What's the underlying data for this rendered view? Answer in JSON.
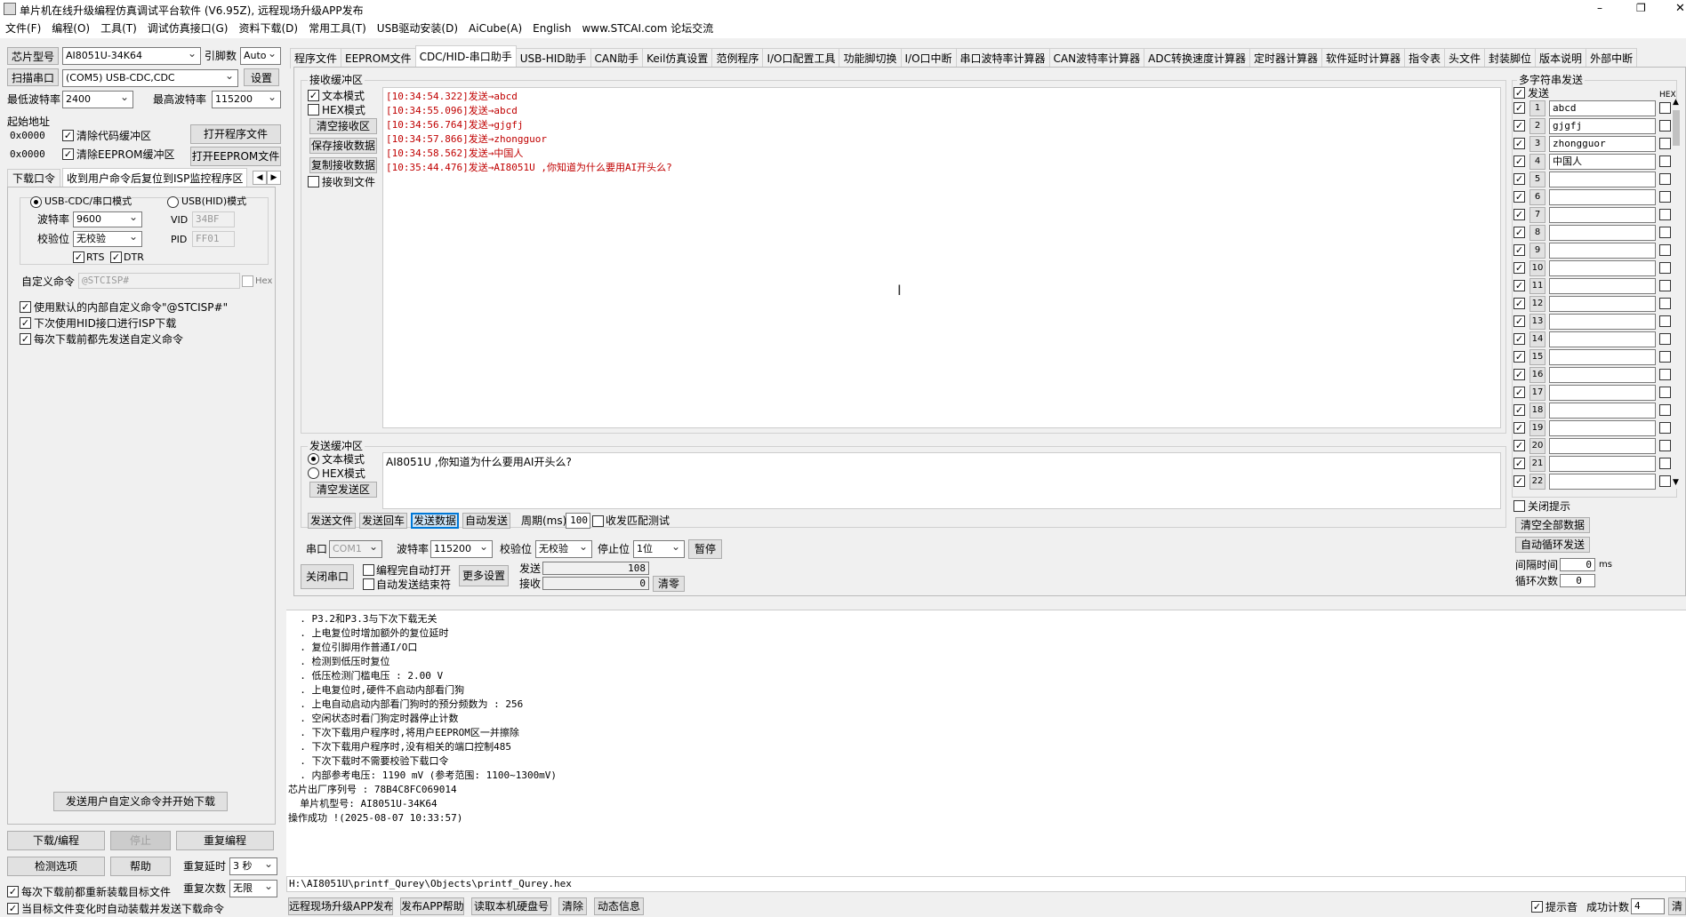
{
  "window": {
    "title": "单片机在线升级编程仿真调试平台软件 (V6.95Z), 远程现场升级APP发布",
    "controls": [
      "–",
      "❐",
      "✕"
    ]
  },
  "menu": [
    "文件(F)",
    "编程(O)",
    "工具(T)",
    "调试仿真接口(G)",
    "资料下载(D)",
    "常用工具(T)",
    "USB驱动安装(D)",
    "AiCube(A)",
    "English",
    "www.STCAI.com 论坛交流"
  ],
  "left": {
    "chip_label": "芯片型号",
    "chip_value": "AI8051U-34K64",
    "pin_label": "引脚数",
    "pin_value": "Auto",
    "scan_label": "扫描串口",
    "port_value": "(COM5) USB-CDC,CDC",
    "settings_label": "设置",
    "min_baud_label": "最低波特率",
    "min_baud_value": "2400",
    "max_baud_label": "最高波特率",
    "max_baud_value": "115200",
    "start_addr_label": "起始地址",
    "addr1": "0x0000",
    "addr2": "0x0000",
    "clear_code_label": "清除代码缓冲区",
    "clear_eeprom_label": "清除EEPROM缓冲区",
    "open_prog_label": "打开程序文件",
    "open_eeprom_label": "打开EEPROM文件",
    "subtab1": "下载口令",
    "subtab2": "收到用户命令后复位到ISP监控程序区",
    "usb_cdc_label": "USB-CDC/串口模式",
    "usb_hid_label": "USB(HID)模式",
    "baud_label": "波特率",
    "baud_value": "9600",
    "parity_label": "校验位",
    "parity_value": "无校验",
    "vid_label": "VID",
    "vid_value": "34BF",
    "pid_label": "PID",
    "pid_value": "FF01",
    "rts_label": "RTS",
    "dtr_label": "DTR",
    "custom_cmd_label": "自定义命令",
    "custom_cmd_value": "@STCISP#",
    "hex_label": "Hex",
    "opt1": "使用默认的内部自定义命令\"@STCISP#\"",
    "opt2": "下次使用HID接口进行ISP下载",
    "opt3": "每次下载前都先发送自定义命令",
    "send_custom_btn": "发送用户自定义命令并开始下载",
    "download_btn": "下载/编程",
    "stop_btn": "停止",
    "reprog_btn": "重复编程",
    "check_btn": "检测选项",
    "help_btn": "帮助",
    "repeat_delay_label": "重复延时",
    "repeat_delay_value": "3 秒",
    "repeat_count_label": "重复次数",
    "repeat_count_value": "无限",
    "reload_label": "每次下载前都重新装载目标文件",
    "autoload_label": "当目标文件变化时自动装载并发送下载命令"
  },
  "tabs": [
    "程序文件",
    "EEPROM文件",
    "CDC/HID-串口助手",
    "USB-HID助手",
    "CAN助手",
    "Keil仿真设置",
    "范例程序",
    "I/O口配置工具",
    "功能脚切换",
    "I/O口中断",
    "串口波特率计算器",
    "CAN波特率计算器",
    "ADC转换速度计算器",
    "定时器计算器",
    "软件延时计算器",
    "指令表",
    "头文件",
    "封装脚位",
    "版本说明",
    "外部中断"
  ],
  "recv": {
    "group_label": "接收缓冲区",
    "text_mode": "文本模式",
    "hex_mode": "HEX模式",
    "clear_btn": "清空接收区",
    "save_btn": "保存接收数据",
    "copy_btn": "复制接收数据",
    "to_file": "接收到文件",
    "lines": [
      "[10:34:54.322]发送→abcd",
      "[10:34:55.096]发送→abcd",
      "[10:34:56.764]发送→gjgfj",
      "[10:34:57.866]发送→zhongguor",
      "[10:34:58.562]发送→中国人",
      "[10:35:44.476]发送→AI8051U ,你知道为什么要用AI开头么?"
    ]
  },
  "send": {
    "group_label": "发送缓冲区",
    "text_mode": "文本模式",
    "hex_mode": "HEX模式",
    "clear_btn": "清空发送区",
    "content": "AI8051U ,你知道为什么要用AI开头么?",
    "send_file": "发送文件",
    "send_enter": "发送回车",
    "send_data": "发送数据",
    "auto_send": "自动发送",
    "period_label": "周期(ms)",
    "period_value": "100",
    "match_test": "收发匹配测试"
  },
  "port": {
    "port_label": "串口",
    "port_value": "COM1",
    "baud_label": "波特率",
    "baud_value": "115200",
    "parity_label": "校验位",
    "parity_value": "无校验",
    "stop_label": "停止位",
    "stop_value": "1位",
    "pause_btn": "暂停",
    "close_btn": "关闭串口",
    "open_after_prog": "编程完自动打开",
    "auto_send_end": "自动发送结束符",
    "more_btn": "更多设置",
    "sent_label": "发送",
    "sent_value": "108",
    "recv_label": "接收",
    "recv_value": "0",
    "clear_btn": "清零"
  },
  "multi": {
    "title": "多字符串发送",
    "send_label": "发送",
    "hex_label": "HEX",
    "rows": [
      {
        "n": "1",
        "v": "abcd"
      },
      {
        "n": "2",
        "v": "gjgfj"
      },
      {
        "n": "3",
        "v": "zhongguor"
      },
      {
        "n": "4",
        "v": "中国人"
      },
      {
        "n": "5",
        "v": ""
      },
      {
        "n": "6",
        "v": ""
      },
      {
        "n": "7",
        "v": ""
      },
      {
        "n": "8",
        "v": ""
      },
      {
        "n": "9",
        "v": ""
      },
      {
        "n": "10",
        "v": ""
      },
      {
        "n": "11",
        "v": ""
      },
      {
        "n": "12",
        "v": ""
      },
      {
        "n": "13",
        "v": ""
      },
      {
        "n": "14",
        "v": ""
      },
      {
        "n": "15",
        "v": ""
      },
      {
        "n": "16",
        "v": ""
      },
      {
        "n": "17",
        "v": ""
      },
      {
        "n": "18",
        "v": ""
      },
      {
        "n": "19",
        "v": ""
      },
      {
        "n": "20",
        "v": ""
      },
      {
        "n": "21",
        "v": ""
      },
      {
        "n": "22",
        "v": ""
      }
    ],
    "close_tip": "关闭提示",
    "clear_all": "清空全部数据",
    "auto_loop": "自动循环发送",
    "interval_label": "间隔时间",
    "interval_value": "0",
    "interval_unit": "ms",
    "loop_label": "循环次数",
    "loop_value": "0"
  },
  "log": {
    "lines": [
      "  . P3.2和P3.3与下次下载无关",
      "  . 上电复位时增加额外的复位延时",
      "  . 复位引脚用作普通I/O口",
      "  . 检测到低压时复位",
      "  . 低压检测门槛电压 : 2.00 V",
      "  . 上电复位时,硬件不启动内部看门狗",
      "  . 上电自动启动内部看门狗时的预分频数为 : 256",
      "  . 空闲状态时看门狗定时器停止计数",
      "  . 下次下载用户程序时,将用户EEPROM区一并擦除",
      "  . 下次下载用户程序时,没有相关的端口控制485",
      "  . 下次下载时不需要校验下载口令",
      "  . 内部参考电压: 1190 mV (参考范围: 1100~1300mV)",
      "芯片出厂序列号 : 78B4C8FC069014",
      "",
      "  单片机型号: AI8051U-34K64",
      "",
      "操作成功 !(2025-08-07 10:33:57)"
    ]
  },
  "path": "H:\\AI8051U\\printf_Qurey\\Objects\\printf_Qurey.hex",
  "bottom": {
    "b1": "远程现场升级APP发布",
    "b2": "发布APP帮助",
    "b3": "读取本机硬盘号",
    "b4": "清除",
    "b5": "动态信息",
    "sound_label": "提示音",
    "count_label": "成功计数",
    "count_value": "4",
    "clear_short": "清"
  }
}
